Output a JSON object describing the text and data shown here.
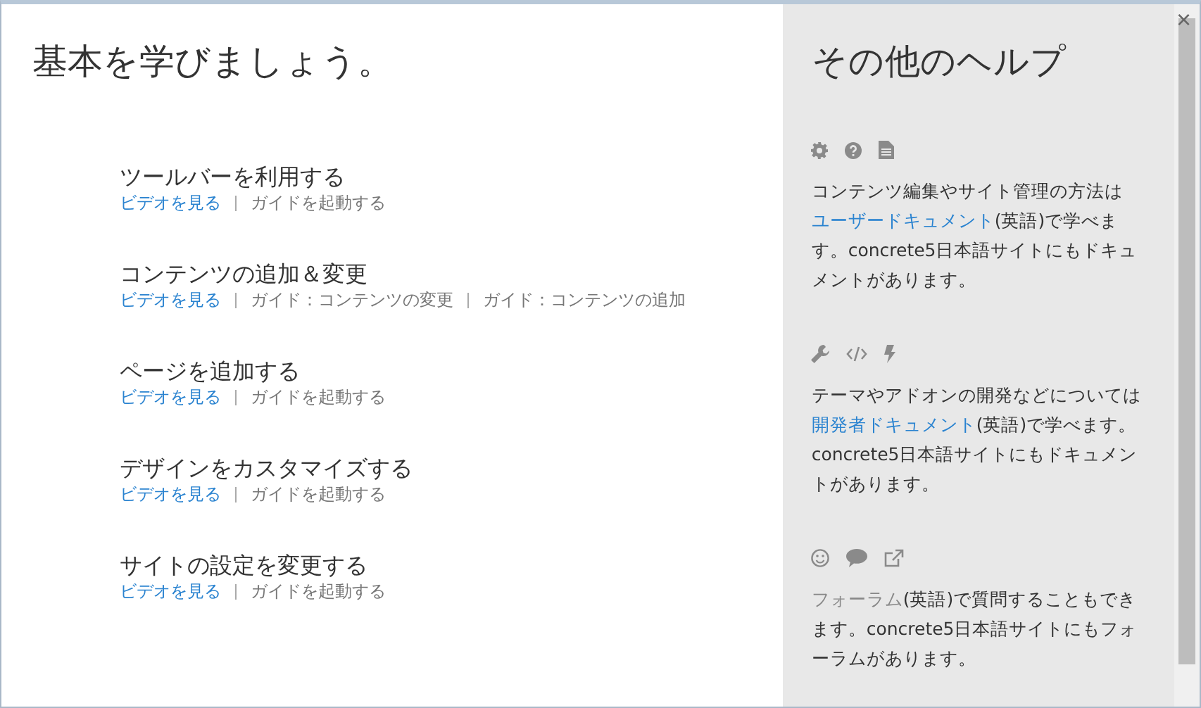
{
  "main": {
    "title": "基本を学びましょう。",
    "topics": [
      {
        "title": "ツールバーを利用する",
        "links": [
          {
            "kind": "video",
            "label": "ビデオを見る"
          },
          {
            "kind": "guide",
            "label": "ガイドを起動する"
          }
        ]
      },
      {
        "title": "コンテンツの追加＆変更",
        "links": [
          {
            "kind": "video",
            "label": "ビデオを見る"
          },
          {
            "kind": "guide",
            "label": "ガイド：コンテンツの変更"
          },
          {
            "kind": "guide",
            "label": "ガイド：コンテンツの追加"
          }
        ]
      },
      {
        "title": "ページを追加する",
        "links": [
          {
            "kind": "video",
            "label": "ビデオを見る"
          },
          {
            "kind": "guide",
            "label": "ガイドを起動する"
          }
        ]
      },
      {
        "title": "デザインをカスタマイズする",
        "links": [
          {
            "kind": "video",
            "label": "ビデオを見る"
          },
          {
            "kind": "guide",
            "label": "ガイドを起動する"
          }
        ]
      },
      {
        "title": "サイトの設定を変更する",
        "links": [
          {
            "kind": "video",
            "label": "ビデオを見る"
          },
          {
            "kind": "guide",
            "label": "ガイドを起動する"
          }
        ]
      }
    ]
  },
  "sidebar": {
    "title": "その他のヘルプ",
    "sections": [
      {
        "parts": [
          {
            "kind": "text",
            "text": "コンテンツ編集やサイト管理の方法は"
          },
          {
            "kind": "link",
            "text": "ユーザードキュメント",
            "visited": false
          },
          {
            "kind": "text",
            "text": "(英語)で学べます。concrete5日本語サイトにもドキュメントがあります。"
          }
        ]
      },
      {
        "parts": [
          {
            "kind": "text",
            "text": "テーマやアドオンの開発などについては"
          },
          {
            "kind": "link",
            "text": "開発者ドキュメント",
            "visited": false
          },
          {
            "kind": "text",
            "text": "(英語)で学べます。concrete5日本語サイトにもドキュメントがあります。"
          }
        ]
      },
      {
        "parts": [
          {
            "kind": "link",
            "text": "フォーラム",
            "visited": true
          },
          {
            "kind": "text",
            "text": "(英語)で質問することもできます。concrete5日本語サイトにもフォーラムがあります。"
          }
        ]
      }
    ]
  },
  "close": "×"
}
